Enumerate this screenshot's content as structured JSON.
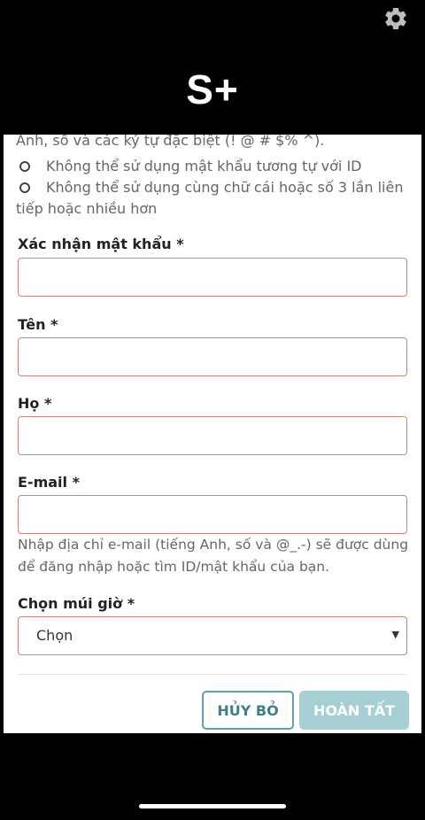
{
  "header": {
    "logo": "S+",
    "settings_icon": "gear-icon"
  },
  "password_rules": {
    "partial_line": "Anh, số và các ký tự đặc biệt (! @ # $% ^).",
    "items": [
      "Không thể sử dụng mật khẩu tương tự với ID",
      "Không thể sử dụng cùng chữ cái hoặc số 3 lần liên tiếp hoặc nhiều hơn"
    ]
  },
  "form": {
    "confirm_password_label": "Xác nhận mật khẩu *",
    "first_name_label": "Tên *",
    "last_name_label": "Họ *",
    "email_label": "E-mail *",
    "email_hint": "Nhập địa chỉ e-mail (tiếng Anh, số và @_.-) sẽ được dùng để đăng nhập hoặc tìm ID/mật khẩu của bạn.",
    "timezone_label": "Chọn múi giờ *",
    "timezone_selected": "Chọn",
    "timezone_arrow": "▼"
  },
  "buttons": {
    "cancel": "HỦY BỎ",
    "done": "HOÀN TẤT"
  },
  "colors": {
    "field_border": "#c9837d",
    "cancel_text": "#3f7f87",
    "cancel_border": "#5aa6ae",
    "done_bg": "#a6cfd4"
  }
}
